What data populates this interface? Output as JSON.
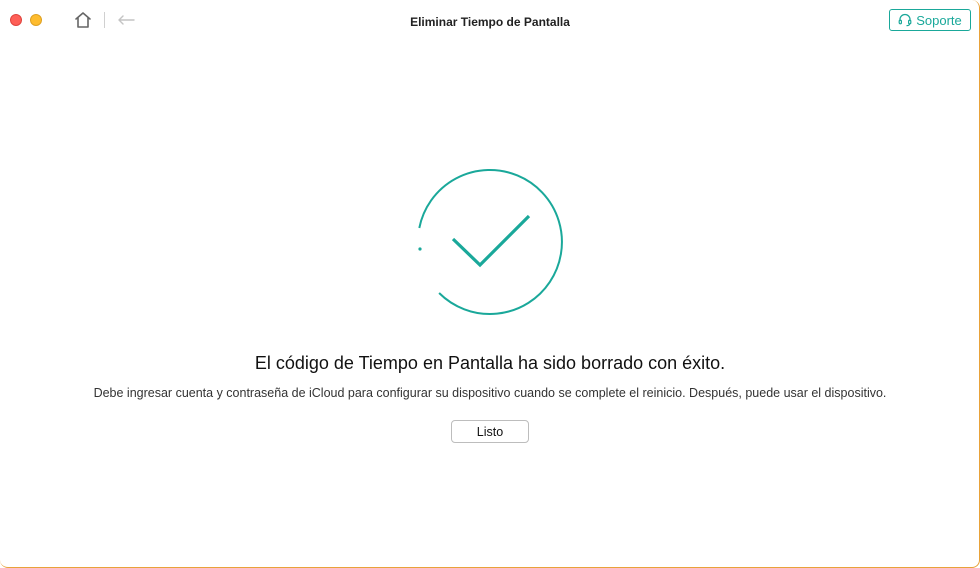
{
  "window": {
    "title": "Eliminar Tiempo de Pantalla"
  },
  "toolbar": {
    "home_icon": "home-icon",
    "back_icon": "back-arrow-icon",
    "support_label": "Soporte",
    "support_icon": "headset-icon"
  },
  "main": {
    "status_icon": "check-circle-icon",
    "headline": "El código de Tiempo en Pantalla ha sido borrado con éxito.",
    "description": "Debe ingresar cuenta y contraseña de iCloud para configurar su dispositivo cuando se complete el reinicio. Después, puede usar el dispositivo.",
    "done_label": "Listo"
  },
  "colors": {
    "accent": "#1aa89a",
    "close": "#fe5f57",
    "minimize": "#febc2e"
  }
}
